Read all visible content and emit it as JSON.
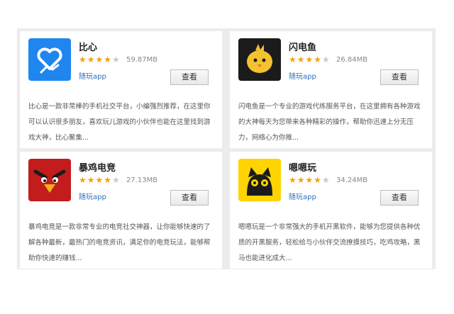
{
  "apps": [
    {
      "name": "比心",
      "rating_full": 4,
      "size": "59.87MB",
      "source": "随玩app",
      "button": "查看",
      "description": "比心是一款非常棒的手机社交平台，小编强烈推荐，在这里你可以认识很多朋友，喜欢玩儿游戏的小伙伴也能在这里找到游戏大神，比心聚集...",
      "icon": "heart-hand-icon",
      "icon_bg": "#1f86f0"
    },
    {
      "name": "闪电鱼",
      "rating_full": 4,
      "size": "26.84MB",
      "source": "随玩app",
      "button": "查看",
      "description": "闪电鱼是一个专业的游戏代练服务平台，在这里拥有各种游戏的大神每天为您带来各种精彩的操作，帮助你迅速上分无压力，网络心为你推...",
      "icon": "yellow-chick-icon",
      "icon_bg": "#1b1b1b"
    },
    {
      "name": "暴鸡电竞",
      "rating_full": 4,
      "size": "27.13MB",
      "source": "随玩app",
      "button": "查看",
      "description": "暴鸡电竞是一款非常专业的电竞社交神器，让你能够快速的了解各种最新，最热门的电竞资讯，满足你的电竞玩法，能够帮助你快速的赚钱...",
      "icon": "angry-bird-icon",
      "icon_bg": "#c21c1c"
    },
    {
      "name": "嗯嗯玩",
      "rating_full": 4,
      "size": "34.24MB",
      "source": "随玩app",
      "button": "查看",
      "description": "嗯嗯玩是一个非常强大的手机开黑软件，能够为您提供各种优质的开黑服务，轻松给与小伙伴交流撩摸技巧，吃鸡攻略，黑马也能进化成大...",
      "icon": "black-cat-icon",
      "icon_bg": "#ffd400"
    }
  ]
}
